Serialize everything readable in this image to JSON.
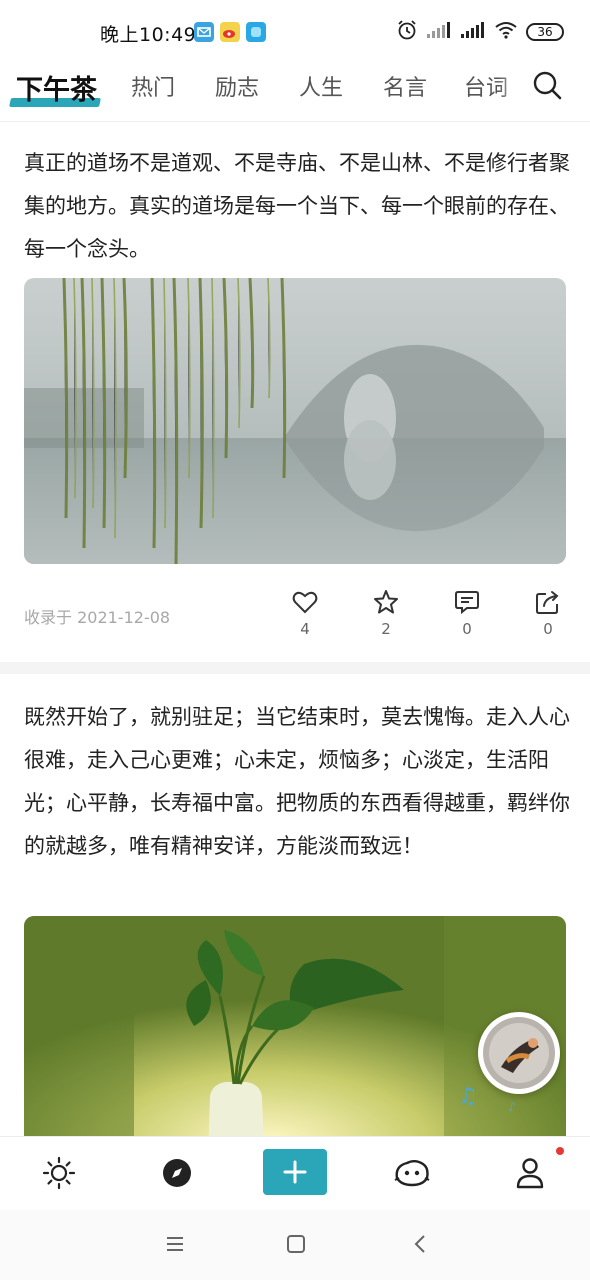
{
  "status_bar": {
    "time": "晚上10:49",
    "battery": "36"
  },
  "tabs": [
    {
      "label": "下午茶",
      "active": true
    },
    {
      "label": "热门"
    },
    {
      "label": "励志"
    },
    {
      "label": "人生"
    },
    {
      "label": "名言"
    },
    {
      "label": "台词"
    }
  ],
  "posts": [
    {
      "text": "真正的道场不是道观、不是寺庙、不是山林、不是修行者聚集的地方。真实的道场是每一个当下、每一个眼前的存在、每一个念头。",
      "image": "misty-lake-arch-bridge-willow",
      "date": "收录于 2021-12-08",
      "likes": "4",
      "favorites": "2",
      "comments": "0",
      "shares": "0"
    },
    {
      "text": "既然开始了，就别驻足；当它结束时，莫去愧悔。走入人心很难，走入己心更难；心未定，烦恼多；心淡定，生活阳光；心平静，长寿福中富。把物质的东西看得越重，羁绊你的就越多，唯有精神安详，方能淡而致远！",
      "image": "green-plant-in-vase"
    }
  ],
  "icons": {
    "status": [
      "mail-app-icon",
      "weibo-icon",
      "blue-app-icon",
      "alarm-icon",
      "signal-icon",
      "wifi-icon",
      "battery-icon"
    ],
    "actions": [
      "heart-icon",
      "star-icon",
      "comment-icon",
      "share-icon"
    ],
    "bottom_nav": [
      "sun-icon",
      "compass-icon",
      "plus-icon",
      "face-icon",
      "user-icon"
    ],
    "system_nav": [
      "menu-icon",
      "home-icon",
      "back-icon"
    ]
  },
  "colors": {
    "accent": "#2aa6b8",
    "notification_dot": "#e53935",
    "muted_text": "#a8a8a8"
  }
}
